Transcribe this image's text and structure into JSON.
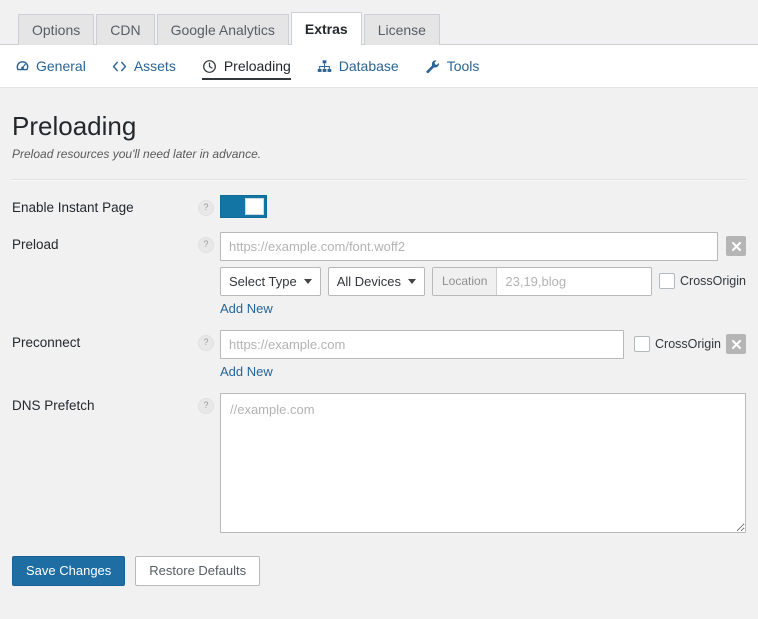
{
  "tabs": [
    {
      "label": "Options",
      "active": false
    },
    {
      "label": "CDN",
      "active": false
    },
    {
      "label": "Google Analytics",
      "active": false
    },
    {
      "label": "Extras",
      "active": true
    },
    {
      "label": "License",
      "active": false
    }
  ],
  "subnav": [
    {
      "label": "General",
      "icon": "speedometer-icon",
      "active": false
    },
    {
      "label": "Assets",
      "icon": "code-brackets-icon",
      "active": false
    },
    {
      "label": "Preloading",
      "icon": "clock-icon",
      "active": true
    },
    {
      "label": "Database",
      "icon": "sitemap-icon",
      "active": false
    },
    {
      "label": "Tools",
      "icon": "wrench-icon",
      "active": false
    }
  ],
  "page": {
    "title": "Preloading",
    "subtitle": "Preload resources you'll need later in advance."
  },
  "help_glyph": "?",
  "rows": {
    "instant_page": {
      "label": "Enable Instant Page",
      "toggle_on": true
    },
    "preload": {
      "label": "Preload",
      "url_placeholder": "https://example.com/font.woff2",
      "url_value": "",
      "type_select": "Select Type",
      "devices_select": "All Devices",
      "location_addon": "Location",
      "location_placeholder": "23,19,blog",
      "location_value": "",
      "crossorigin_label": "CrossOrigin",
      "crossorigin_checked": false,
      "add_new": "Add New"
    },
    "preconnect": {
      "label": "Preconnect",
      "url_placeholder": "https://example.com",
      "url_value": "",
      "crossorigin_label": "CrossOrigin",
      "crossorigin_checked": false,
      "add_new": "Add New"
    },
    "dns_prefetch": {
      "label": "DNS Prefetch",
      "placeholder": "//example.com",
      "value": ""
    }
  },
  "footer": {
    "save_label": "Save Changes",
    "restore_label": "Restore Defaults"
  },
  "colors": {
    "accent": "#1e6ea3",
    "toggle_on": "#1275a3",
    "link": "#2a6496",
    "page_bg": "#f1f1f1",
    "delete_btn": "#b5b5b5"
  }
}
